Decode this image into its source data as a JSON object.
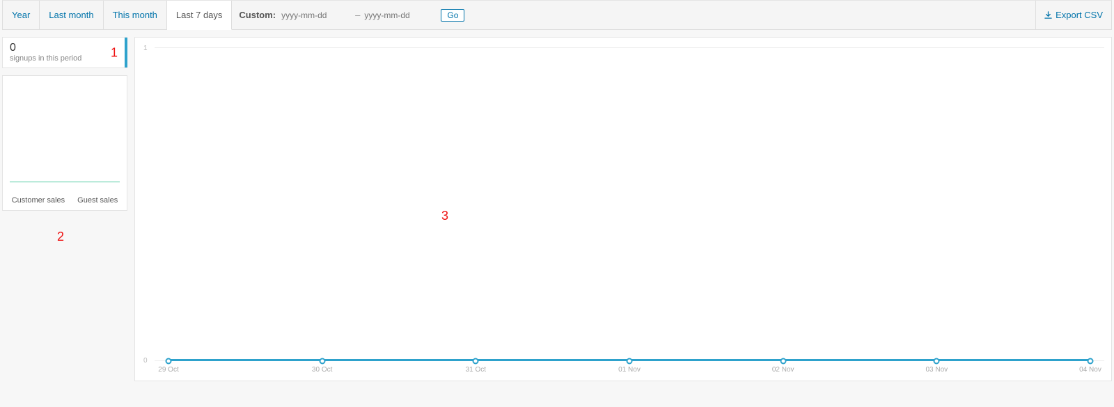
{
  "toolbar": {
    "tabs": [
      "Year",
      "Last month",
      "This month",
      "Last 7 days"
    ],
    "active_tab": "Last 7 days",
    "custom_label": "Custom:",
    "date_placeholder_from": "yyyy-mm-dd",
    "date_range_sep": "–",
    "date_placeholder_to": "yyyy-mm-dd",
    "go_label": "Go",
    "export_label": "Export CSV"
  },
  "stat_card": {
    "value": "0",
    "caption": "signups in this period"
  },
  "mini_chart": {
    "legend_a": "Customer sales",
    "legend_b": "Guest sales"
  },
  "annotations": {
    "a1": "1",
    "a2": "2",
    "a3": "3"
  },
  "chart_data": {
    "type": "line",
    "title": "",
    "xlabel": "",
    "ylabel": "",
    "ylim": [
      0,
      1
    ],
    "yticks": [
      0,
      1
    ],
    "categories": [
      "29 Oct",
      "30 Oct",
      "31 Oct",
      "01 Nov",
      "02 Nov",
      "03 Nov",
      "04 Nov"
    ],
    "series": [
      {
        "name": "signups",
        "values": [
          0,
          0,
          0,
          0,
          0,
          0,
          0
        ],
        "color": "#2ea2cc"
      }
    ]
  }
}
